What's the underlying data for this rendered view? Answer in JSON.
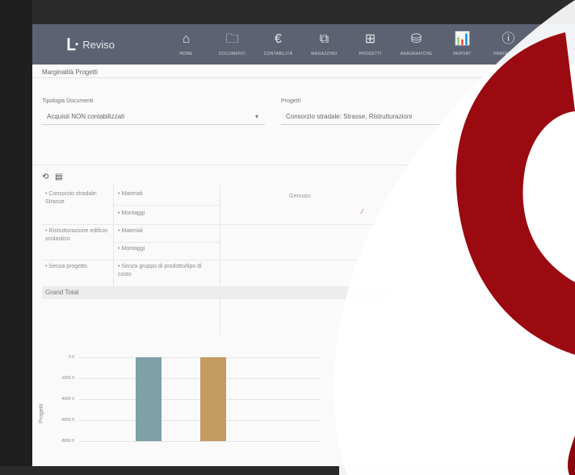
{
  "brand": {
    "mark": "ᒷ",
    "name": "Reviso"
  },
  "nav": [
    {
      "icon": "home-icon",
      "glyph": "⌂",
      "label": "HOME"
    },
    {
      "icon": "folder-icon",
      "glyph": "🗀",
      "label": "DOCUMENTI"
    },
    {
      "icon": "euro-icon",
      "glyph": "€",
      "label": "CONTABILITÀ"
    },
    {
      "icon": "inventory-icon",
      "glyph": "⧉",
      "label": "MAGAZZINO"
    },
    {
      "icon": "grid-icon",
      "glyph": "⊞",
      "label": "PROGETTI"
    },
    {
      "icon": "database-icon",
      "glyph": "⛁",
      "label": "ANAGRAFICHE"
    },
    {
      "icon": "chart-icon",
      "glyph": "📊",
      "label": "REPORT"
    },
    {
      "icon": "info-icon",
      "glyph": "ⓘ",
      "label": "PREFERENZE"
    }
  ],
  "page": {
    "title": "Marginalità Progetti"
  },
  "filters": {
    "document_type": {
      "label": "Tipologia Documenti",
      "value": "Acquisti NON contabilizzati"
    },
    "projects": {
      "label": "Progetti",
      "value": "Consorzio stradale: Strasse, Ristrutturazioni"
    }
  },
  "toolbar": {
    "refresh_icon": "refresh-icon",
    "export_icon": "export-icon"
  },
  "pivot": {
    "column_header": "Gennaio",
    "rows": [
      {
        "project": "• Consorzio stradale: Strasse",
        "items": [
          "• Materiali",
          "• Montaggi"
        ]
      },
      {
        "project": "• Ristrutturazione edificio scolastico",
        "items": [
          "• Materiali",
          "• Montaggi"
        ]
      },
      {
        "project": "• Senza progetto",
        "items": [
          "• Senza gruppo di prodotto/tipo di costo"
        ]
      }
    ],
    "grand_total_label": "Grand Total"
  },
  "chart_data": {
    "type": "bar",
    "ylabel": "Progetti",
    "y_ticks": [
      "0 €",
      "-2000 €",
      "-4000 €",
      "-6000 €",
      "-8000 €"
    ],
    "ylim": [
      -8000,
      0
    ],
    "categories": [
      "",
      ""
    ],
    "values": [
      -8000,
      -8000
    ],
    "colors": [
      "#7fa0a6",
      "#c49b62"
    ]
  },
  "colors": {
    "nav_bg": "#5d6273",
    "accent_red": "#9b0a10"
  }
}
